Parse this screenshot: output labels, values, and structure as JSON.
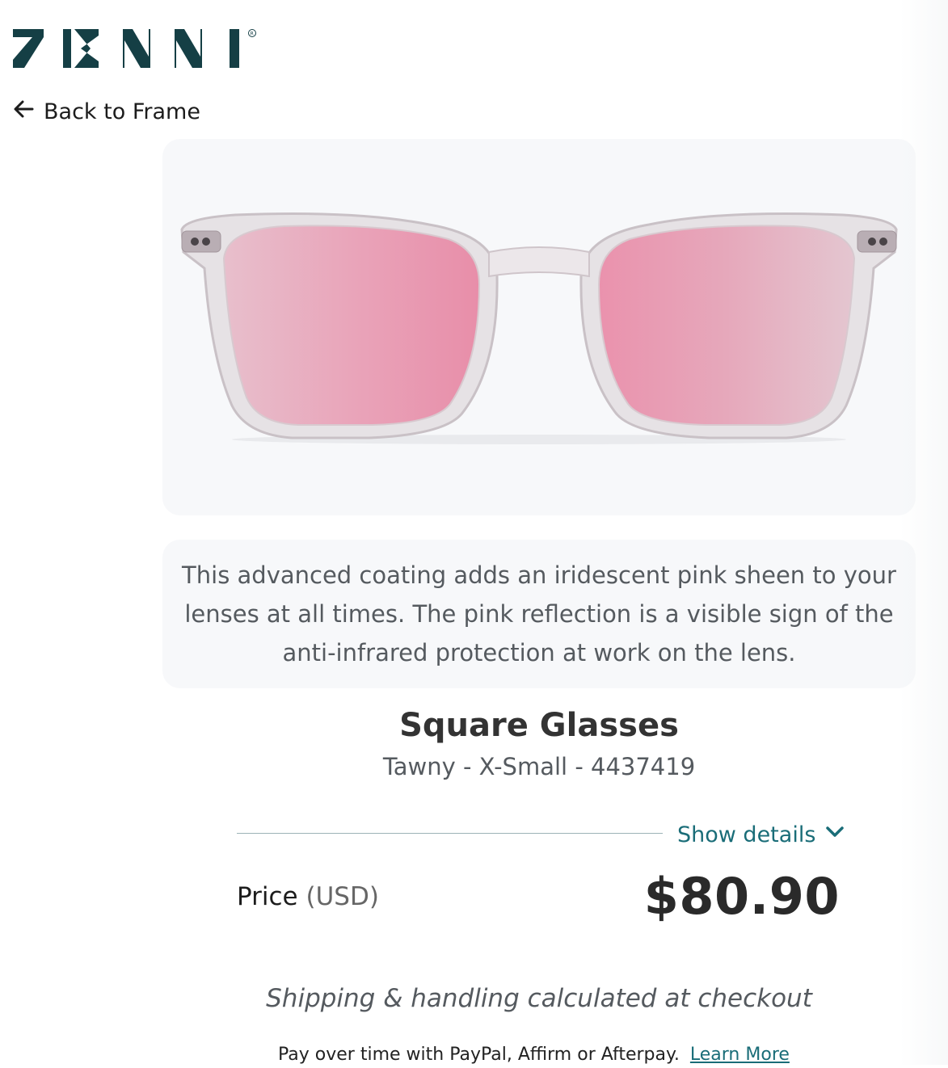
{
  "header": {
    "logo_text": "ZENNI",
    "logo_icon": "zenni-logo",
    "back_label": "Back to Frame",
    "back_icon": "arrow-left-icon"
  },
  "product": {
    "image_alt": "Square Glasses with pink lenses",
    "description": "This advanced coating adds an iridescent pink sheen to your lenses at all times. The pink reflection is a visible sign of the anti-infrared protection at work on the lens.",
    "name": "Square Glasses",
    "variant": "Tawny - X-Small - 4437419"
  },
  "pricing": {
    "show_details_label": "Show details",
    "show_details_icon": "chevron-down-icon",
    "price_label": "Price",
    "price_currency": "(USD)",
    "price_value": "$80.90",
    "shipping_note": "Shipping & handling calculated at checkout",
    "payment_note": "Pay over time with PayPal, Affirm or Afterpay.",
    "learn_more_label": "Learn More"
  },
  "colors": {
    "brand": "#153f45",
    "link": "#1a6d78",
    "panel_bg": "#f7f8fa",
    "lens_pink": "#e899b2"
  }
}
